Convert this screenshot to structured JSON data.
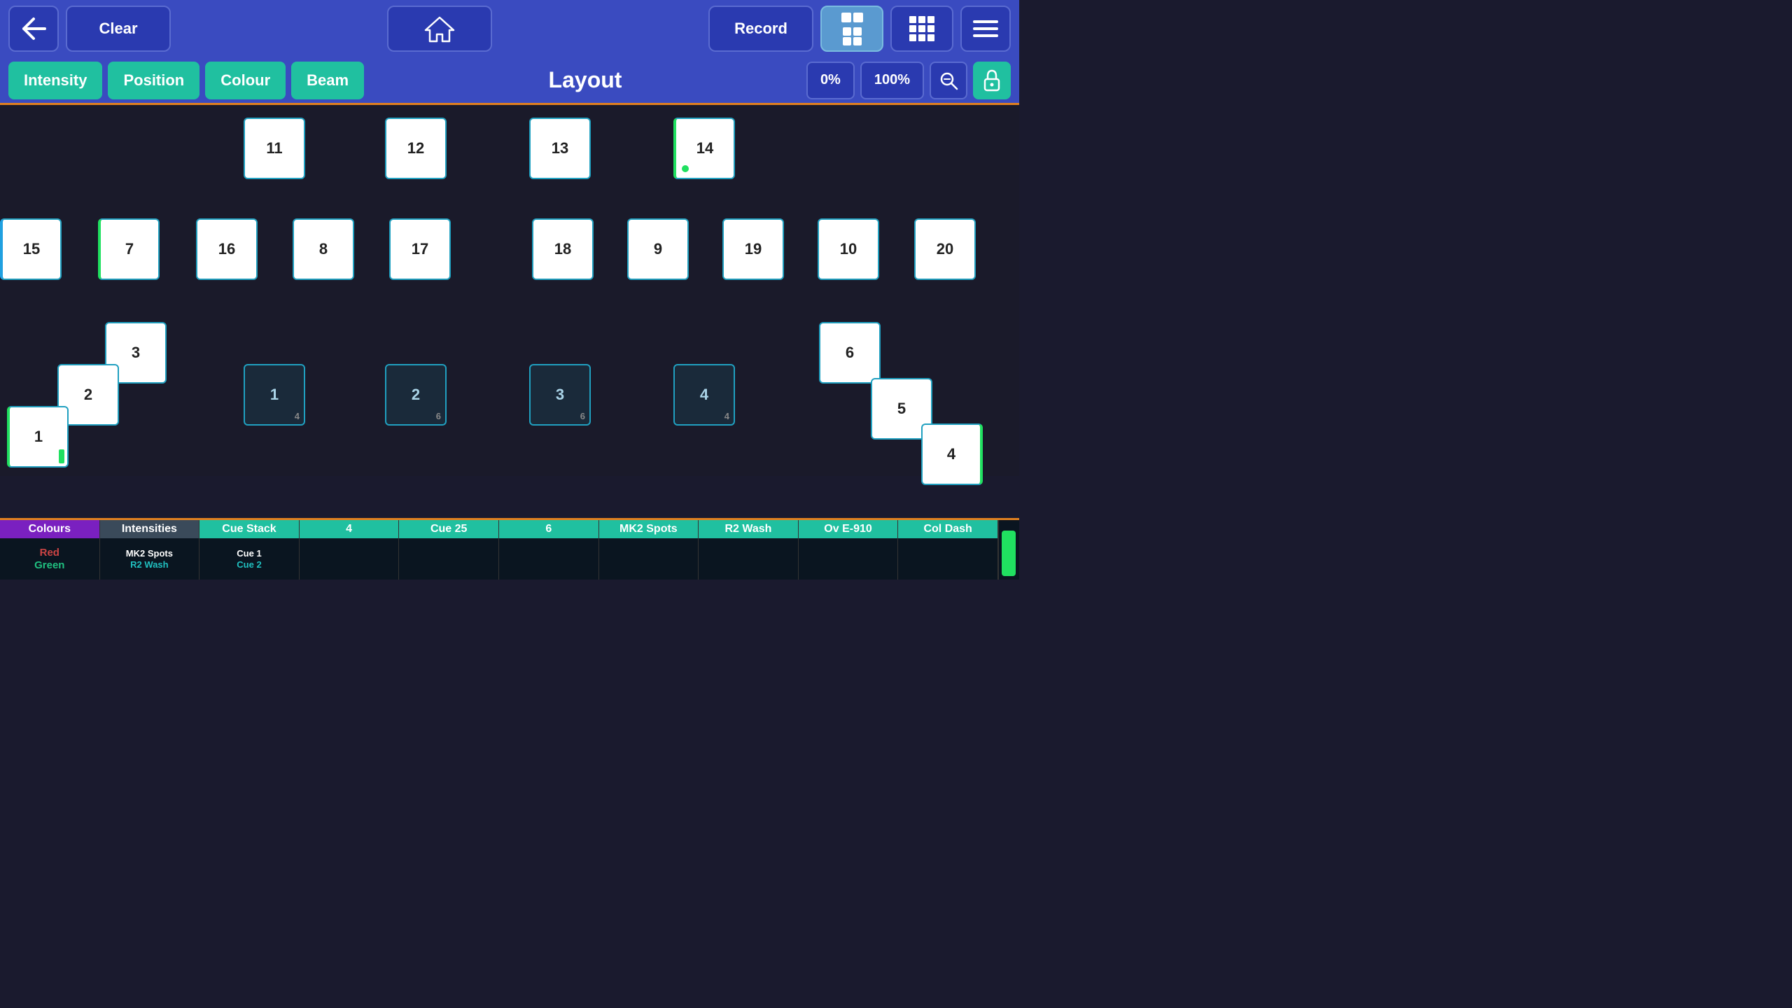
{
  "header": {
    "back_label": "↩",
    "clear_label": "Clear",
    "home_label": "⌂",
    "record_label": "Record",
    "menu_label": "≡"
  },
  "subheader": {
    "tabs": [
      {
        "id": "intensity",
        "label": "Intensity"
      },
      {
        "id": "position",
        "label": "Position"
      },
      {
        "id": "colour",
        "label": "Colour"
      },
      {
        "id": "beam",
        "label": "Beam"
      }
    ],
    "title": "Layout",
    "pct0": "0%",
    "pct100": "100%",
    "zoom_label": "🔍",
    "lock_label": "🔒"
  },
  "fixtures_row1": [
    {
      "id": "f11",
      "num": "11"
    },
    {
      "id": "f12",
      "num": "12"
    },
    {
      "id": "f13",
      "num": "13"
    },
    {
      "id": "f14",
      "num": "14"
    }
  ],
  "fixtures_row2": [
    {
      "id": "f15",
      "num": "15"
    },
    {
      "id": "f7",
      "num": "7"
    },
    {
      "id": "f16",
      "num": "16"
    },
    {
      "id": "f8",
      "num": "8"
    },
    {
      "id": "f17",
      "num": "17"
    },
    {
      "id": "f18",
      "num": "18"
    },
    {
      "id": "f9",
      "num": "9"
    },
    {
      "id": "f19",
      "num": "19"
    },
    {
      "id": "f10",
      "num": "10"
    },
    {
      "id": "f20",
      "num": "20"
    }
  ],
  "fixtures_row3_left": [
    {
      "id": "f3",
      "num": "3"
    },
    {
      "id": "f2",
      "num": "2"
    },
    {
      "id": "f1",
      "num": "1"
    }
  ],
  "fixtures_row3_dark": [
    {
      "id": "fd1",
      "num": "1",
      "sub": "4"
    },
    {
      "id": "fd2",
      "num": "2",
      "sub": "6"
    },
    {
      "id": "fd3",
      "num": "3",
      "sub": "6"
    },
    {
      "id": "fd4",
      "num": "4",
      "sub": "4"
    }
  ],
  "fixtures_row3_right": [
    {
      "id": "f6",
      "num": "6"
    },
    {
      "id": "f5",
      "num": "5"
    },
    {
      "id": "f4r",
      "num": "4"
    }
  ],
  "bottom_bar": {
    "cells": [
      {
        "id": "colours",
        "header": "Colours",
        "header_class": "purple",
        "lines": [
          {
            "text": "Red",
            "class": ""
          },
          {
            "text": "Green",
            "class": "green"
          }
        ]
      },
      {
        "id": "intensities",
        "header": "Intensities",
        "header_class": "gray",
        "lines": [
          {
            "text": "MK2 Spots",
            "class": "white"
          },
          {
            "text": "R2 Wash",
            "class": "teal"
          }
        ]
      },
      {
        "id": "cue_stack",
        "header": "Cue Stack",
        "header_class": "",
        "lines": [
          {
            "text": "Cue 1",
            "class": "white"
          },
          {
            "text": "Cue 2",
            "class": "teal"
          }
        ]
      },
      {
        "id": "cell4",
        "header": "4",
        "header_class": "",
        "lines": []
      },
      {
        "id": "cue25",
        "header": "Cue 25",
        "header_class": "",
        "lines": []
      },
      {
        "id": "cell6",
        "header": "6",
        "header_class": "",
        "lines": []
      },
      {
        "id": "mk2spots",
        "header": "MK2 Spots",
        "header_class": "",
        "lines": []
      },
      {
        "id": "r2wash",
        "header": "R2 Wash",
        "header_class": "",
        "lines": []
      },
      {
        "id": "ove910",
        "header": "Ov E-910",
        "header_class": "",
        "lines": []
      },
      {
        "id": "coldash",
        "header": "Col Dash",
        "header_class": "",
        "lines": []
      }
    ]
  }
}
